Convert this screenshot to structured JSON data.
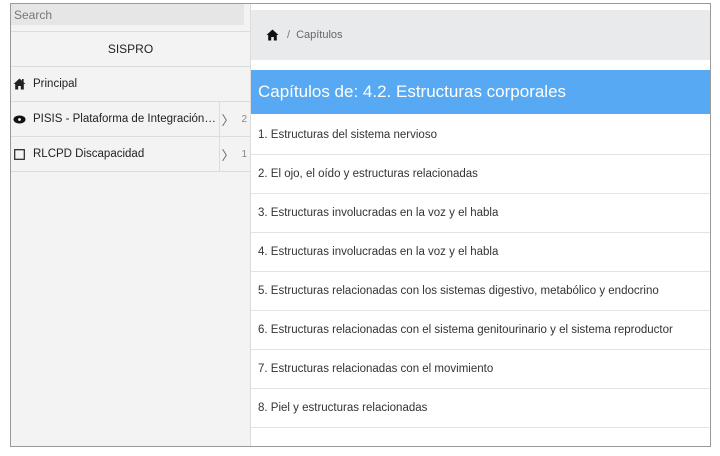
{
  "search": {
    "placeholder": "Search",
    "value": ""
  },
  "sidebar": {
    "brand": "SISPRO",
    "items": [
      {
        "icon": "home-icon",
        "label": "Principal"
      },
      {
        "icon": "eye-icon",
        "label": "PISIS - Plataforma de Integración d...",
        "count": "2"
      },
      {
        "icon": "square-icon",
        "label": "RLCPD Discapacidad",
        "count": "1"
      }
    ]
  },
  "breadcrumb": {
    "home_icon": "home-icon",
    "separator": "/",
    "current": "Capítulos"
  },
  "main": {
    "heading": "Capítulos de: 4.2. Estructuras corporales",
    "chapters": [
      "1. Estructuras del sistema nervioso",
      "2. El ojo, el oído y estructuras relacionadas",
      "3. Estructuras involucradas en la voz y el habla",
      "4. Estructuras involucradas en la voz y el habla",
      "5. Estructuras relacionadas con los sistemas digestivo, metabólico y endocrino",
      "6. Estructuras relacionadas con el sistema genitourinario y el sistema reproductor",
      "7. Estructuras relacionadas con el movimiento",
      "8. Piel y estructuras relacionadas"
    ]
  },
  "colors": {
    "heading_bg": "#56a9f2",
    "topbar_bg": "#e9eaec",
    "sidebar_bg": "#f3f3f3"
  }
}
